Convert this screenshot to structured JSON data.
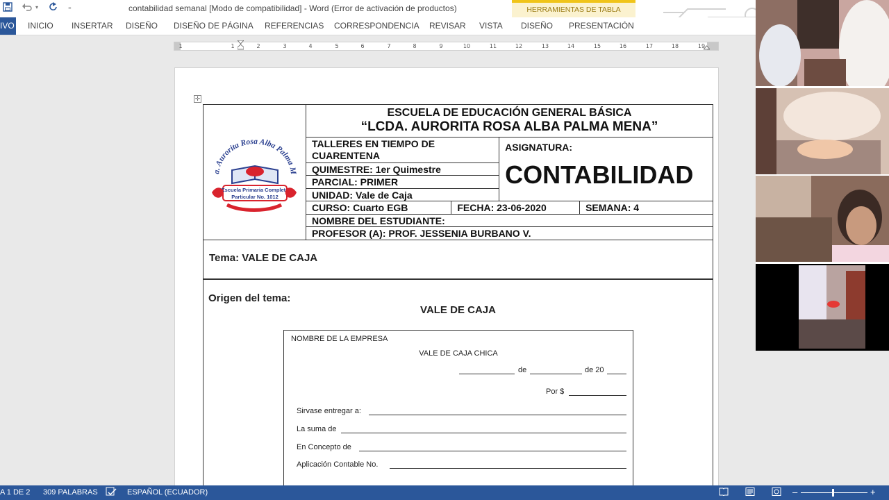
{
  "app": {
    "window_title": "contabilidad semanal [Modo de compatibilidad] - Word (Error de activación de productos)",
    "context_tab_group": "HERRAMIENTAS DE TABLA",
    "quick_access": [
      "save-icon",
      "undo-icon",
      "redo-icon",
      "customize-icon"
    ]
  },
  "ribbon": {
    "file_tab": "IVO",
    "tabs": [
      "INICIO",
      "INSERTAR",
      "DISEÑO",
      "DISEÑO DE PÁGINA",
      "REFERENCIAS",
      "CORRESPONDENCIA",
      "REVISAR",
      "VISTA",
      "DISEÑO",
      "PRESENTACIÓN"
    ]
  },
  "ruler": {
    "numbers": [
      "1",
      "1",
      "2",
      "3",
      "4",
      "5",
      "6",
      "7",
      "8",
      "9",
      "10",
      "11",
      "12",
      "13",
      "14",
      "15",
      "16",
      "17",
      "18",
      "19"
    ]
  },
  "document": {
    "school_line1": "ESCUELA DE EDUCACIÓN GENERAL BÁSICA",
    "school_line2": "“LCDA. AURORITA ROSA ALBA PALMA MENA”",
    "talleres": "TALLERES EN TIEMPO DE CUARENTENA",
    "asignatura_label": "ASIGNATURA:",
    "asignatura_value": "CONTABILIDAD",
    "quimestre": "QUIMESTRE: 1er Quimestre",
    "parcial": "PARCIAL: PRIMER",
    "unidad": "UNIDAD: Vale de Caja",
    "curso": "CURSO: Cuarto EGB",
    "fecha": "FECHA: 23-06-2020",
    "semana": "SEMANA: 4",
    "estudiante": "NOMBRE DEL ESTUDIANTE:",
    "profesor": "PROFESOR (A): PROF. JESSENIA BURBANO V.",
    "logo_text": {
      "arc": "Lcda. Aurorita Rosa Alba Palma Mena",
      "line1": "Escuela Primaria Completa",
      "line2": "Particular No. 1012"
    },
    "tema": "Tema: VALE DE CAJA",
    "origen": "Origen del tema:",
    "vale_title": "VALE DE CAJA",
    "voucher": {
      "empresa": "NOMBRE DE LA EMPRESA",
      "title": "VALE DE CAJA CHICA",
      "de1": "de",
      "de2": "de 20",
      "por": "Por $",
      "sirvase": "Sirvase entregar a:",
      "suma": "La suma de",
      "concepto": "En Concepto de",
      "aplicacion": "Aplicación Contable No."
    }
  },
  "status_bar": {
    "page": "A 1 DE 2",
    "words": "309 PALABRAS",
    "language": "ESPAÑOL (ECUADOR)"
  },
  "colors": {
    "word_blue": "#2b579a",
    "context_yellow": "#f0c419",
    "logo_red": "#d9232d",
    "logo_blue": "#2a3f8f"
  }
}
